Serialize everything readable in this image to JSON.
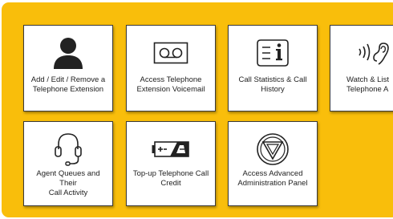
{
  "colors": {
    "panel_background": "#f9be0b",
    "tile_background": "#ffffff",
    "icon_color": "#222222"
  },
  "tiles": [
    {
      "name": "Add / Edit / Remove a Telephone Extension",
      "line1": "Add / Edit / Remove a",
      "line2": "Telephone Extension",
      "icon": "user-icon"
    },
    {
      "name": "Access Telephone Extension Voicemail",
      "line1": "Access Telephone",
      "line2": "Extension Voicemail",
      "icon": "voicemail-icon"
    },
    {
      "name": "Call Statistics & Call History",
      "line1": "Call Statistics & Call",
      "line2": "History",
      "icon": "info-document-icon"
    },
    {
      "name": "Watch & Listen Telephone Activity (partially visible)",
      "line1": "Watch & List",
      "line2": "Telephone A",
      "icon": "listen-ear-icon"
    },
    {
      "name": "Agent Queues and Their Call Activity",
      "line1": "Agent Queues and Their",
      "line2": "Call Activity",
      "icon": "headset-icon"
    },
    {
      "name": "Top-up Telephone Call Credit",
      "line1": "Top-up Telephone Call",
      "line2": "Credit",
      "icon": "battery-charge-icon"
    },
    {
      "name": "Access Advanced Administration Panel",
      "line1": "Access Advanced",
      "line2": "Administration Panel",
      "icon": "admin-triangle-icon"
    }
  ]
}
